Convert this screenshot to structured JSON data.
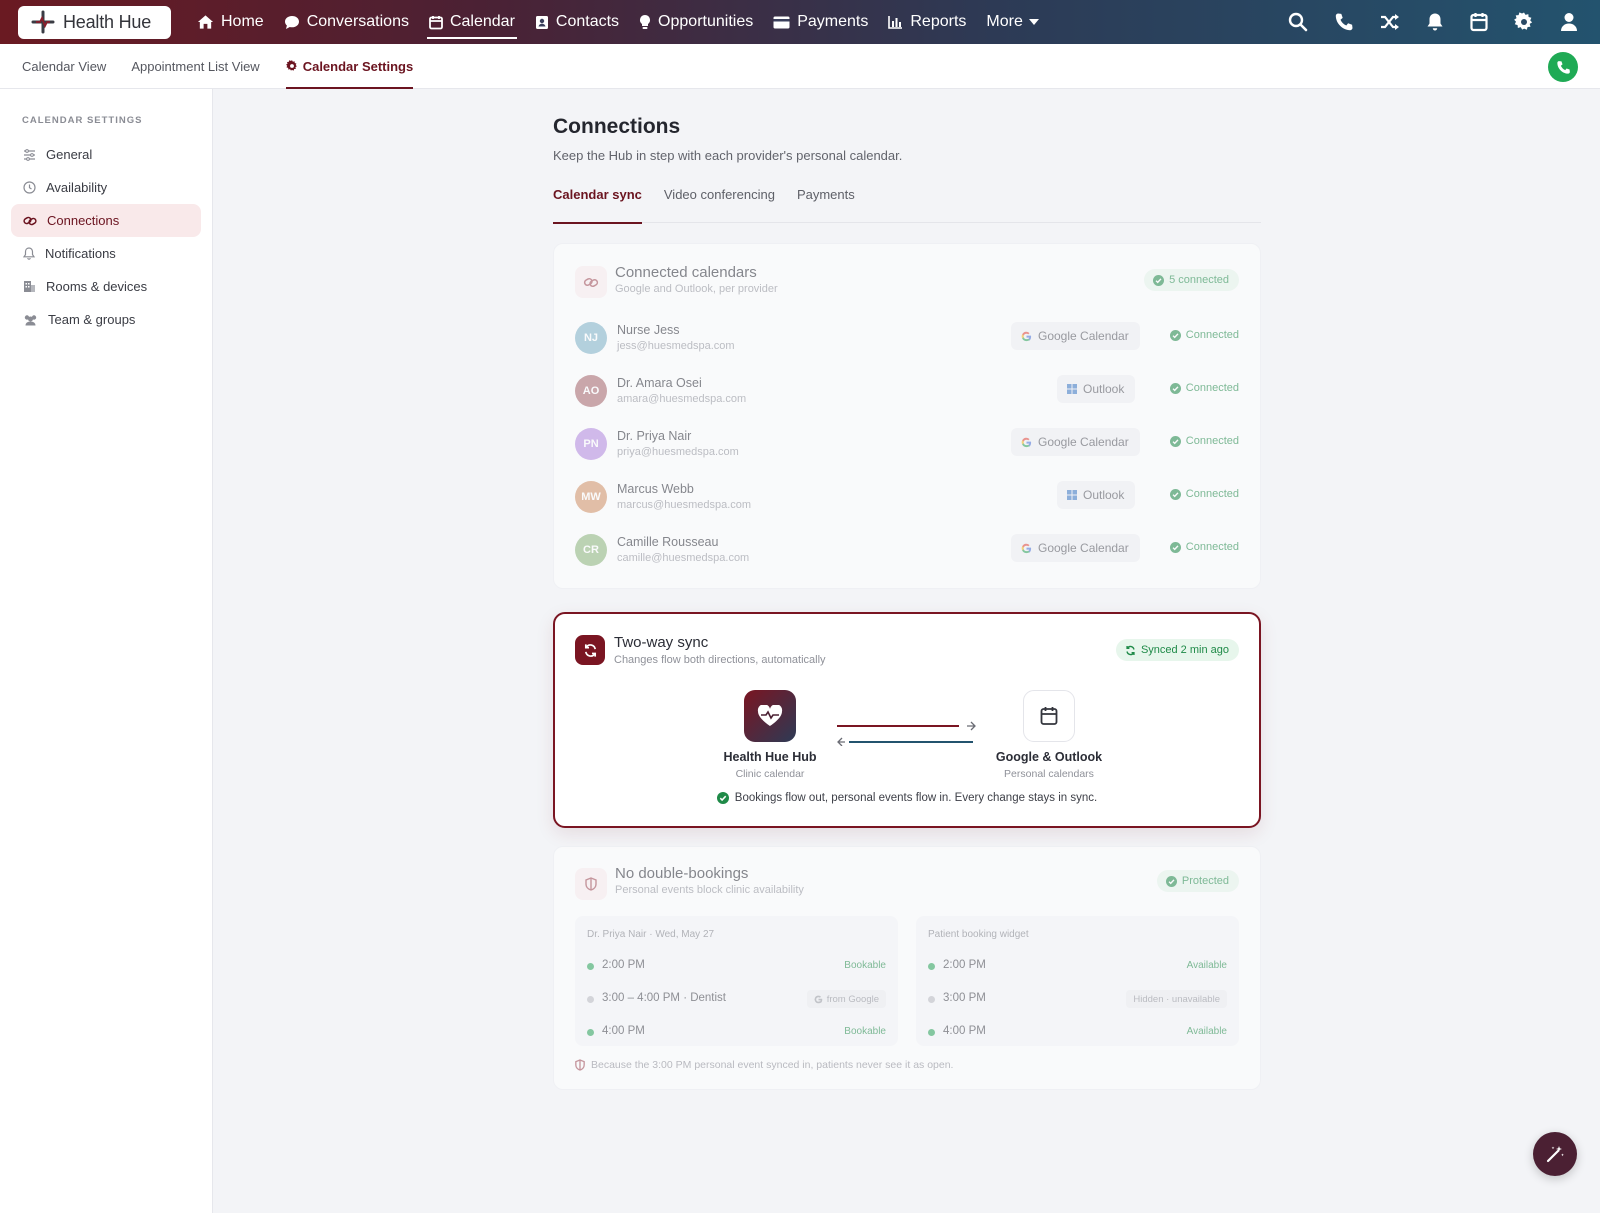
{
  "brand": {
    "name": "Health Hue"
  },
  "nav": {
    "items": [
      {
        "label": "Home",
        "icon": "home-icon"
      },
      {
        "label": "Conversations",
        "icon": "chat-icon"
      },
      {
        "label": "Calendar",
        "icon": "calendar-icon",
        "active": true
      },
      {
        "label": "Contacts",
        "icon": "contact-card-icon"
      },
      {
        "label": "Opportunities",
        "icon": "lightbulb-icon"
      },
      {
        "label": "Payments",
        "icon": "credit-card-icon"
      },
      {
        "label": "Reports",
        "icon": "bar-chart-icon"
      },
      {
        "label": "More",
        "icon": "chevron-down-icon"
      }
    ],
    "right_icons": [
      "search-icon",
      "phone-icon",
      "shuffle-icon",
      "bell-icon",
      "calendar-icon",
      "gear-icon",
      "user-icon"
    ]
  },
  "subnav": {
    "tabs": [
      "Calendar View",
      "Appointment List View",
      "Calendar Settings"
    ],
    "active": "Calendar Settings"
  },
  "sidebar": {
    "heading": "CALENDAR SETTINGS",
    "items": [
      {
        "label": "General",
        "icon": "sliders-icon"
      },
      {
        "label": "Availability",
        "icon": "clock-icon"
      },
      {
        "label": "Connections",
        "icon": "link-icon",
        "active": true
      },
      {
        "label": "Notifications",
        "icon": "bell-icon"
      },
      {
        "label": "Rooms & devices",
        "icon": "building-icon"
      },
      {
        "label": "Team & groups",
        "icon": "users-icon"
      }
    ]
  },
  "page": {
    "title": "Connections",
    "subtitle": "Keep the Hub in step with each provider's personal calendar.",
    "tabs": [
      "Calendar sync",
      "Video conferencing",
      "Payments"
    ],
    "active_tab": "Calendar sync"
  },
  "connected": {
    "title": "Connected calendars",
    "subtitle": "Google and Outlook, per provider",
    "badge": "5 connected",
    "rows": [
      {
        "initials": "NJ",
        "name": "Nurse Jess",
        "email": "jess@huesmedspa.com",
        "provider": "Google Calendar",
        "status": "Connected",
        "color": "#7fb3c8"
      },
      {
        "initials": "AO",
        "name": "Dr. Amara Osei",
        "email": "amara@huesmedspa.com",
        "provider": "Outlook",
        "status": "Connected",
        "color": "#a8676c"
      },
      {
        "initials": "PN",
        "name": "Dr. Priya Nair",
        "email": "priya@huesmedspa.com",
        "provider": "Google Calendar",
        "status": "Connected",
        "color": "#b48ae0"
      },
      {
        "initials": "MW",
        "name": "Marcus Webb",
        "email": "marcus@huesmedspa.com",
        "provider": "Outlook",
        "status": "Connected",
        "color": "#d49366"
      },
      {
        "initials": "CR",
        "name": "Camille Rousseau",
        "email": "camille@huesmedspa.com",
        "provider": "Google Calendar",
        "status": "Connected",
        "color": "#8fb77d"
      }
    ]
  },
  "sync": {
    "title": "Two-way sync",
    "subtitle": "Changes flow both directions, automatically",
    "badge": "Synced 2 min ago",
    "left": {
      "name": "Health Hue Hub",
      "sub": "Clinic calendar"
    },
    "right": {
      "name": "Google & Outlook",
      "sub": "Personal calendars"
    },
    "note": "Bookings flow out, personal events flow in. Every change stays in sync."
  },
  "double": {
    "title": "No double-bookings",
    "subtitle": "Personal events block clinic availability",
    "badge": "Protected",
    "left_col": {
      "heading": "Dr. Priya Nair · Wed, May 27",
      "slots": [
        {
          "time": "2:00 PM",
          "tag": "Bookable"
        },
        {
          "time": "3:00 – 4:00 PM · Dentist",
          "tag": "from Google"
        },
        {
          "time": "4:00 PM",
          "tag": "Bookable"
        }
      ]
    },
    "right_col": {
      "heading": "Patient booking widget",
      "slots": [
        {
          "time": "2:00 PM",
          "tag": "Available"
        },
        {
          "time": "3:00 PM",
          "tag": "Hidden · unavailable"
        },
        {
          "time": "4:00 PM",
          "tag": "Available"
        }
      ]
    },
    "footnote": "Because the 3:00 PM personal event synced in, patients never see it as open."
  },
  "colors": {
    "brand": "#6b1420",
    "success": "#1f8a48",
    "accent_dark": "#4b2033"
  }
}
